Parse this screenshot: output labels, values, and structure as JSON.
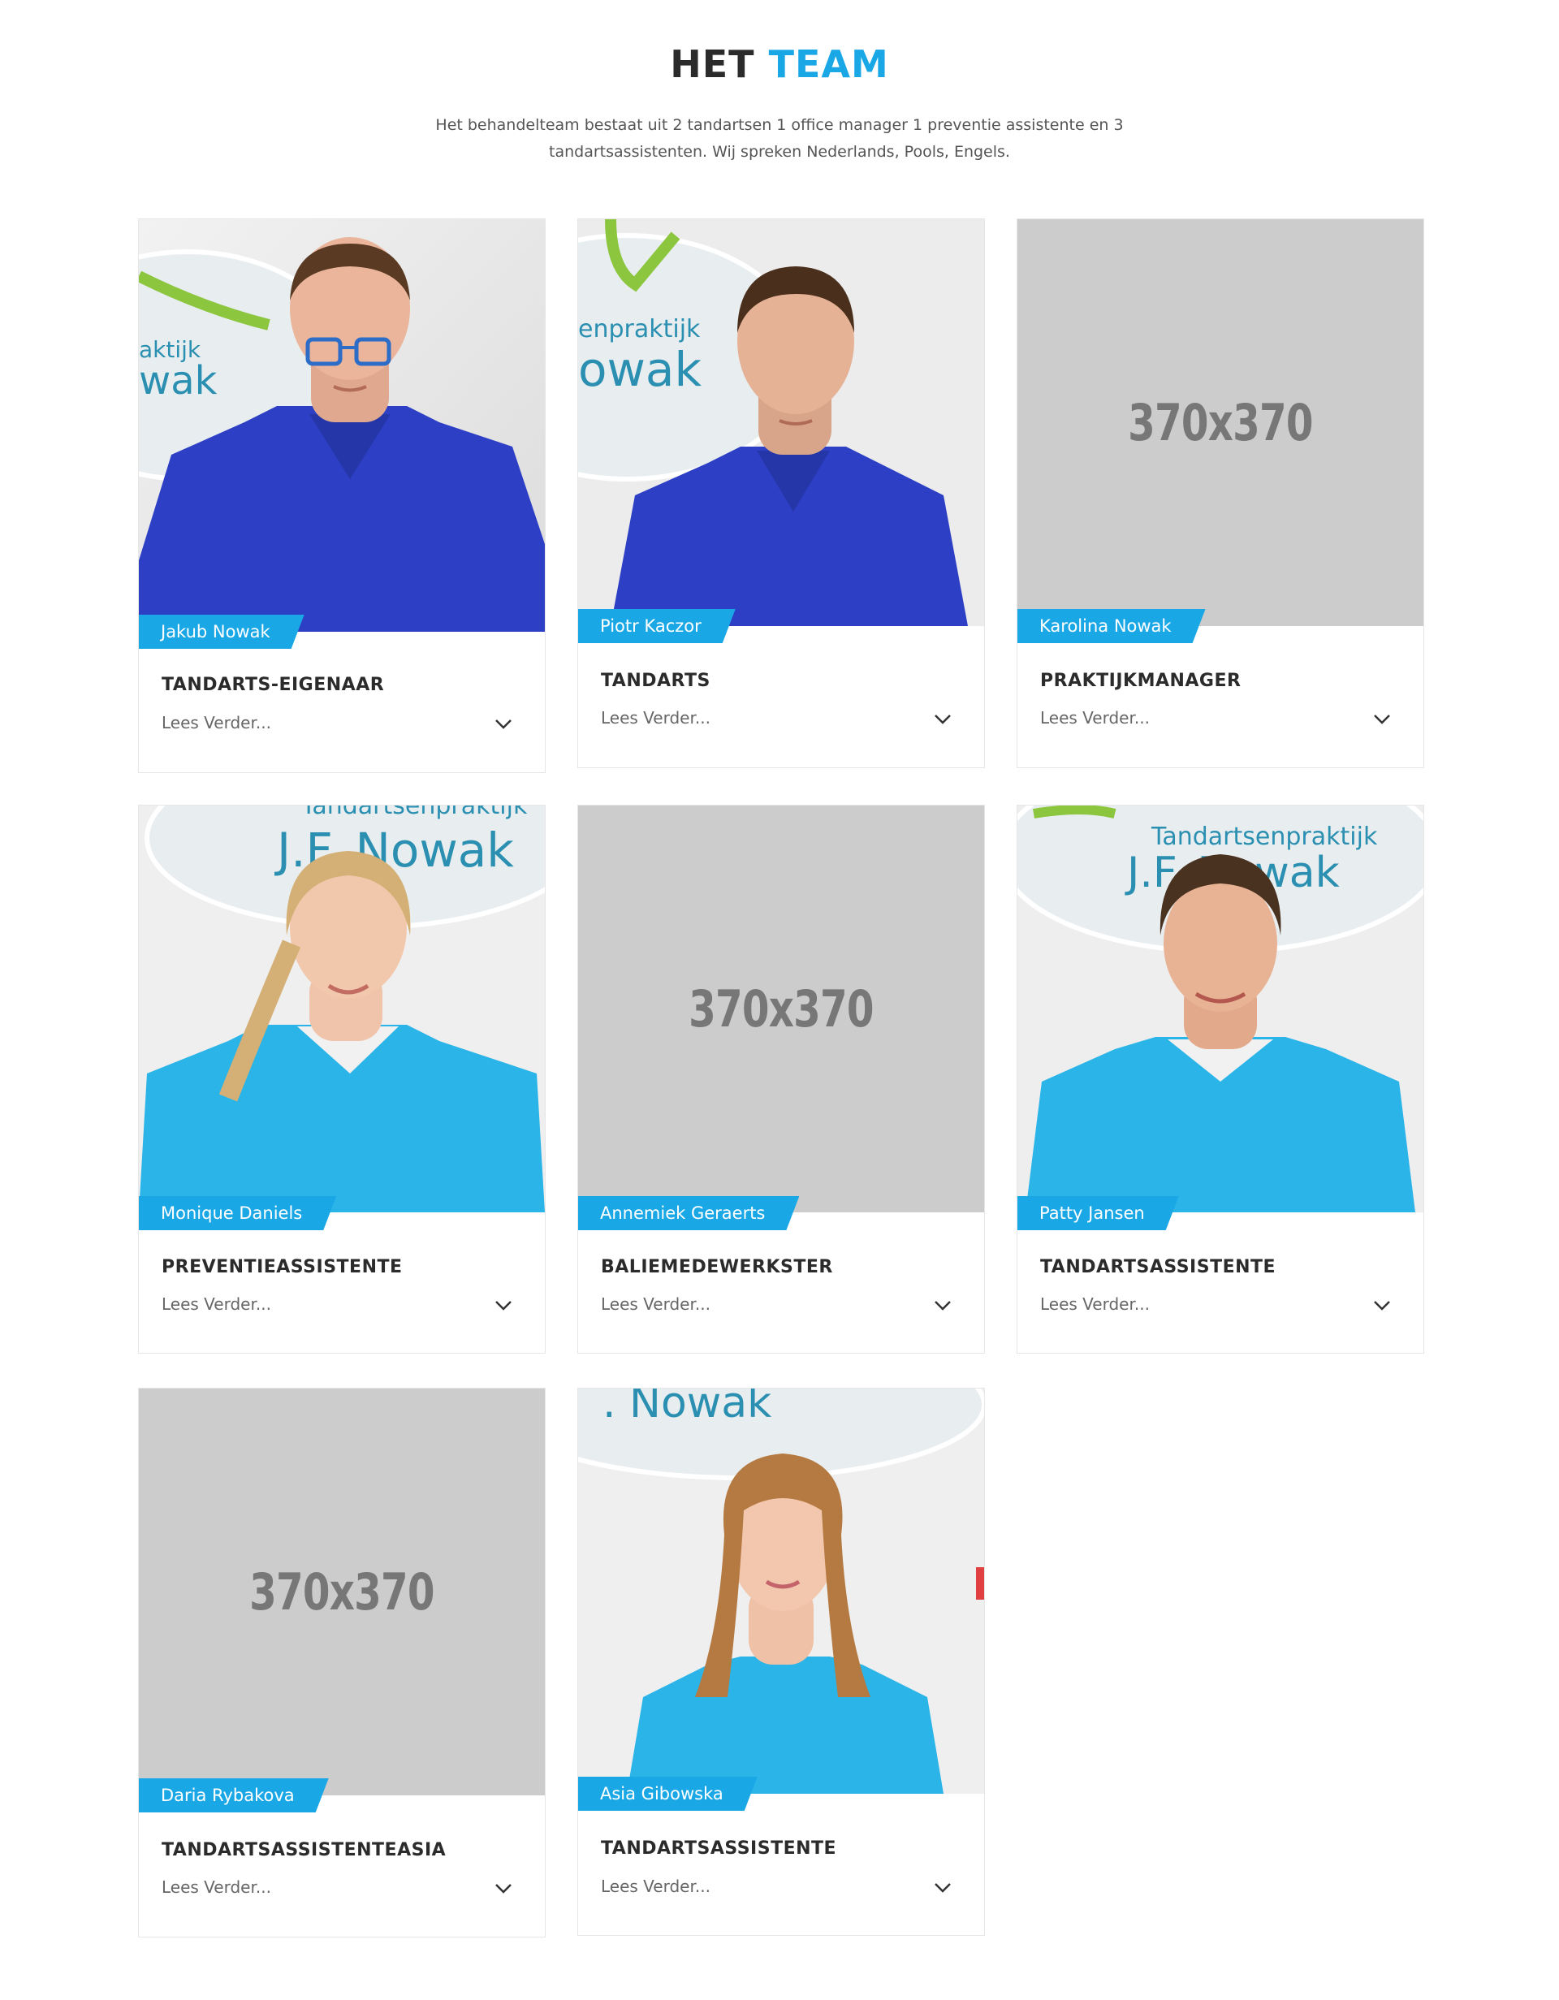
{
  "header": {
    "title_part1": "HET",
    "title_part2": "TEAM",
    "description": "Het behandelteam bestaat uit 2 tandartsen 1 office manager 1 preventie assistente en 3 tandartsassistenten. Wij spreken Nederlands, Pools, Engels."
  },
  "colors": {
    "accent": "#1aa7e6",
    "placeholder": "#cccccc",
    "heading": "#2b2b2b"
  },
  "members": [
    {
      "name": "Jakub Nowak",
      "role": "TANDARTS-EIGENAAR",
      "more": "Lees Verder...",
      "image": "photo-dentist-blue-uniform-glasses"
    },
    {
      "name": "Piotr Kaczor",
      "role": "TANDARTS",
      "more": "Lees Verder...",
      "image": "photo-dentist-blue-uniform"
    },
    {
      "name": "Karolina Nowak",
      "role": "PRAKTIJKMANAGER",
      "more": "Lees Verder...",
      "image": "placeholder",
      "placeholder_text": "370x370"
    },
    {
      "name": "Monique Daniels",
      "role": "PREVENTIEASSISTENTE",
      "more": "Lees Verder...",
      "image": "photo-assistant-light-blue-uniform-blonde-braid"
    },
    {
      "name": "Annemiek Geraerts",
      "role": "BALIEMEDEWERKSTER",
      "more": "Lees Verder...",
      "image": "placeholder",
      "placeholder_text": "370x370"
    },
    {
      "name": "Patty Jansen",
      "role": "TANDARTSASSISTENTE",
      "more": "Lees Verder...",
      "image": "photo-assistant-light-blue-uniform-short-hair"
    },
    {
      "name": "Daria Rybakova",
      "role": "TANDARTSASSISTENTEASIA",
      "more": "Lees Verder...",
      "image": "placeholder",
      "placeholder_text": "370x370"
    },
    {
      "name": "Asia Gibowska",
      "role": "TANDARTSASSISTENTE",
      "more": "Lees Verder...",
      "image": "photo-assistant-light-blue-uniform-long-hair"
    }
  ],
  "wall_logo_text": [
    "Tandartsenpraktijk",
    "J.F. Nowak"
  ]
}
